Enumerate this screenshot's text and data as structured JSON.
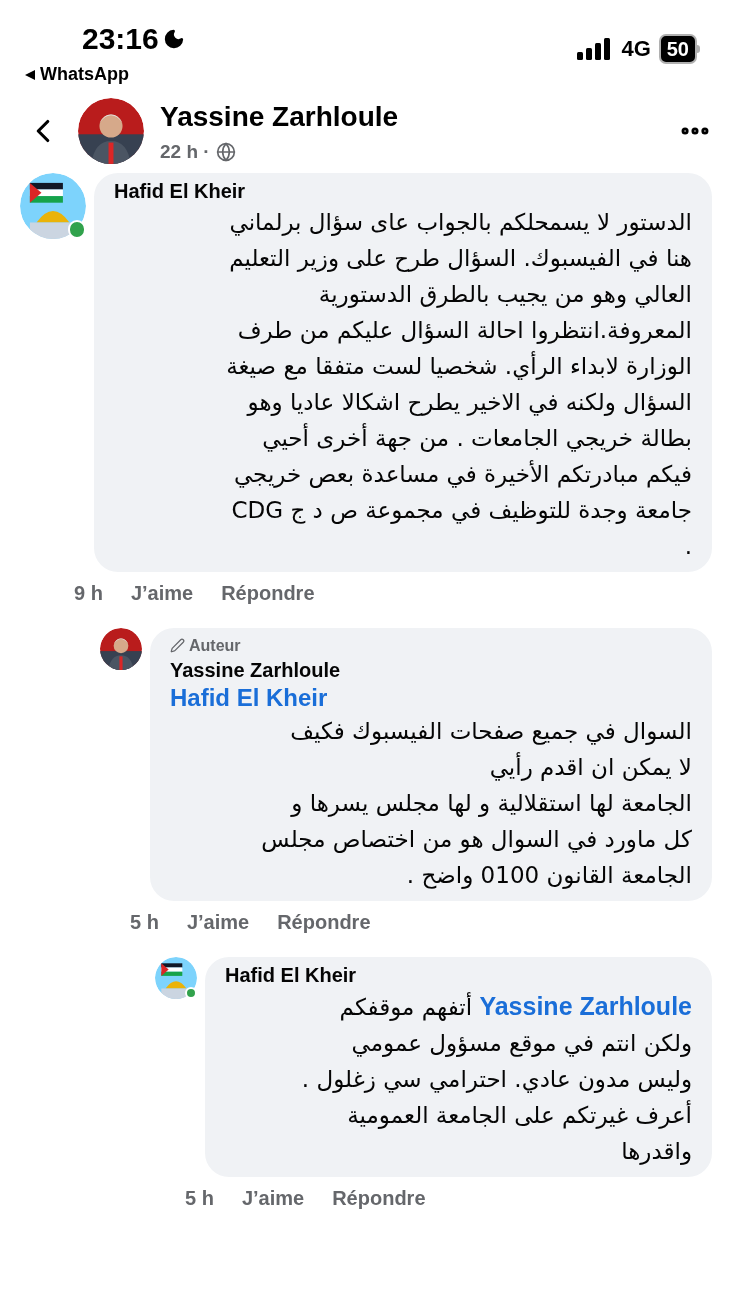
{
  "status_bar": {
    "time": "23:16",
    "back_app": "WhatsApp",
    "network": "4G",
    "battery": "50"
  },
  "post_header": {
    "author": "Yassine Zarhloule",
    "time": "22 h ·"
  },
  "comments": [
    {
      "author": "Hafid El Kheir",
      "online": true,
      "text": "الدستور لا يسمحلكم بالجواب عاى سؤال برلماني\nهنا في الفيسبوك. السؤال طرح على وزير التعليم\nالعالي وهو من يجيب بالطرق الدستورية\nالمعروفة.انتظروا احالة السؤال عليكم من طرف\nالوزارة لابداء الرأي. شخصيا لست متفقا مع صيغة\nالسؤال ولكنه في الاخير يطرح اشكالا عاديا وهو\nبطالة خريجي الجامعات . من جهة أخرى أحيي\nفيكم مبادرتكم الأخيرة في مساعدة بعص خريجي\nجامعة وجدة للتوظيف في مجموعة ص د ج CDG\n.",
      "time": "9 h",
      "like": "J’aime",
      "reply": "Répondre",
      "children": [
        {
          "author": "Yassine Zarhloule",
          "online": false,
          "author_badge": "Auteur",
          "mention_line": "Hafid El Kheir",
          "text": "السوال في جميع صفحات الفيسبوك   فكيف\nلا يمكن ان اقدم رأيي\nالجامعة لها استقلالية و لها مجلس يسرها و\nكل ماورد في السوال هو من اختصاص مجلس\nالجامعة  القانون 0100 واضح .",
          "time": "5 h",
          "like": "J’aime",
          "reply": "Répondre",
          "children": [
            {
              "author": "Hafid El Kheir",
              "online": true,
              "mention": "Yassine Zarhloule",
              "text": "أتفهم موقفكم\nولكن انتم في موقع مسؤول عمومي\nوليس مدون عادي. احترامي سي زغلول .\nأعرف غيرتكم على الجامعة العمومية\nواقدرها",
              "time": "5 h",
              "like": "J’aime",
              "reply": "Répondre"
            }
          ]
        }
      ]
    }
  ]
}
